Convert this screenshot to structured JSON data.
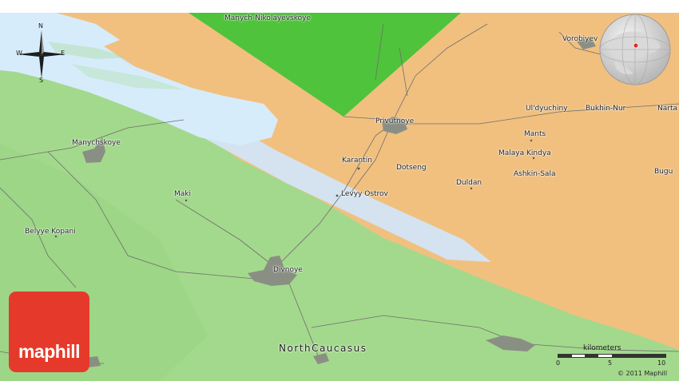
{
  "map": {
    "colors": {
      "green_region": "#a3d98c",
      "green_region_dark": "#87c86f",
      "bright_green_region": "#4fc33b",
      "orange_region": "#f1c07f",
      "water": "#d6ecfb",
      "water_strip": "#d4e3ef",
      "road": "#6e6e6e",
      "town": "#8a8f84",
      "logo": "#e53a2b"
    },
    "places": [
      {
        "name": "Manych-Nikolayevskoye"
      },
      {
        "name": "Vorobiyev"
      },
      {
        "name": "Ul'dyuchiny"
      },
      {
        "name": "Bukhin-Nur"
      },
      {
        "name": "Narta"
      },
      {
        "name": "Privutnoye"
      },
      {
        "name": "Mants"
      },
      {
        "name": "Malaya Kindya"
      },
      {
        "name": "Manychskoye"
      },
      {
        "name": "Karantin"
      },
      {
        "name": "Ashkin-Sala"
      },
      {
        "name": "Bugu"
      },
      {
        "name": "Dotseng"
      },
      {
        "name": "Duldan"
      },
      {
        "name": "Maki"
      },
      {
        "name": "Levyy Ostrov"
      },
      {
        "name": "Belyye Kopani"
      },
      {
        "name": "Divnoye"
      }
    ],
    "region_label": "NorthCaucasus",
    "compass": {
      "n": "N",
      "s": "S",
      "e": "E",
      "w": "W"
    },
    "scale": {
      "title": "kilometers",
      "ticks": [
        "0",
        "5",
        "10"
      ]
    },
    "copyright": "© 2011 Maphill",
    "logo_text": "maphill"
  }
}
